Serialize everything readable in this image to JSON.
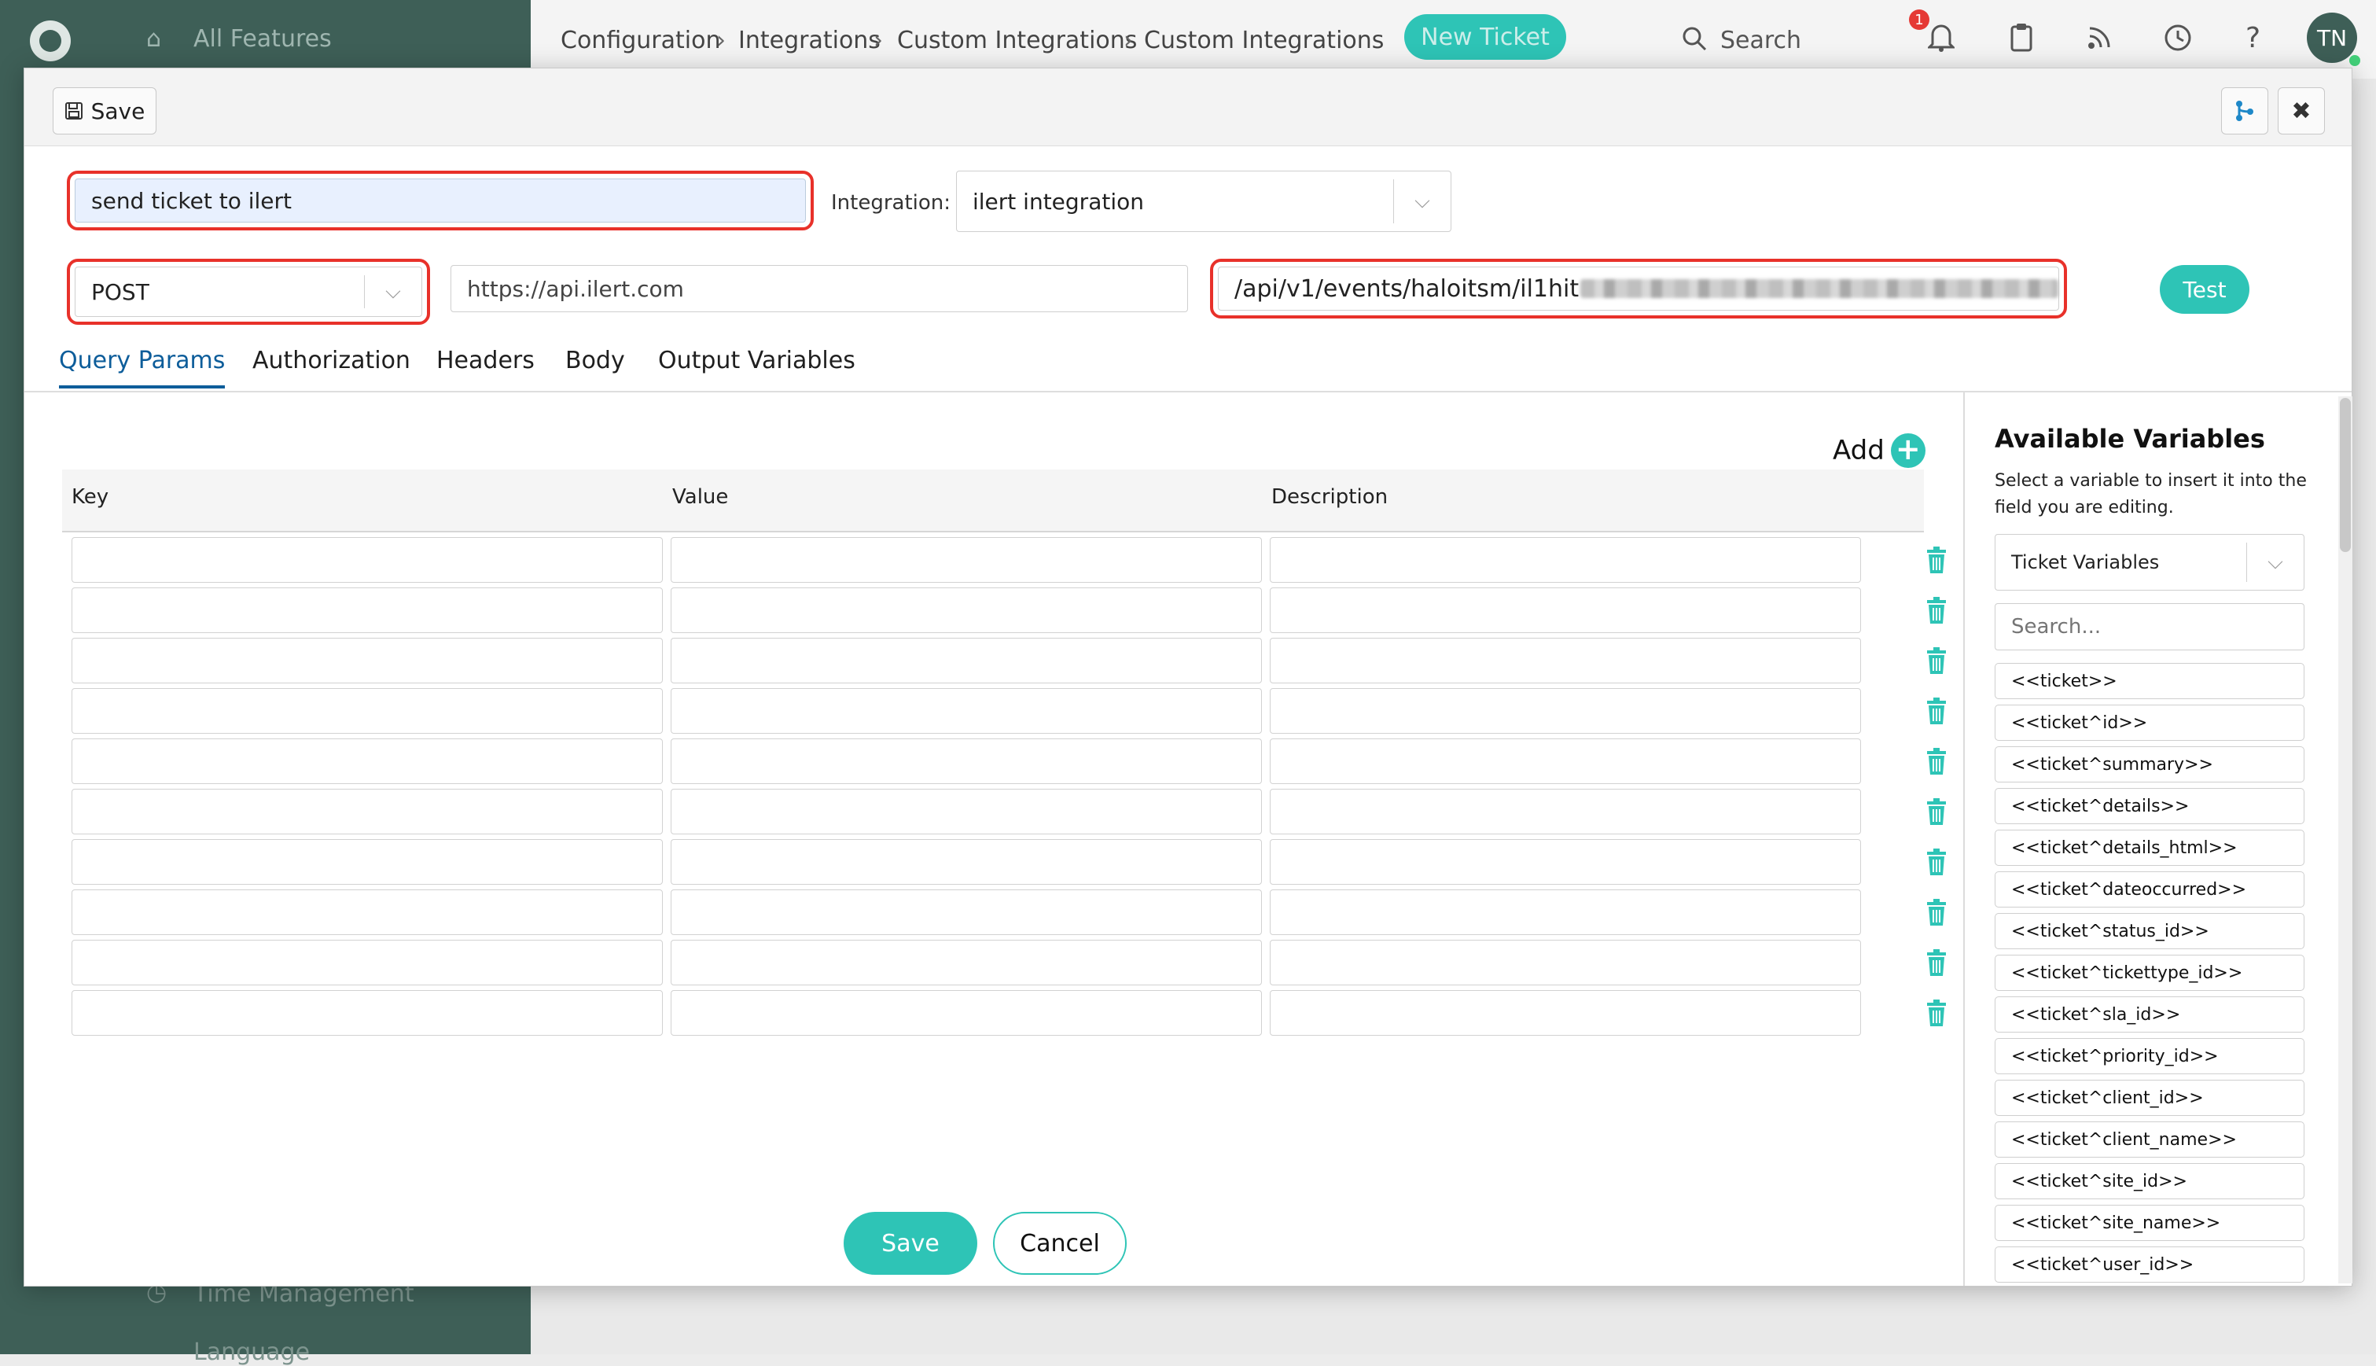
{
  "background": {
    "sidebar_top_item": "All Features",
    "sidebar_bottom_item": "Time Management",
    "sidebar_partial_item": "Language",
    "breadcrumb": [
      "Configuration",
      "Integrations",
      "Custom Integrations",
      "Custom Integrations"
    ],
    "new_ticket_label": "New Ticket",
    "search_label": "Search",
    "notification_count": "1",
    "avatar_initials": "TN"
  },
  "modal": {
    "toolbar": {
      "save_label": "Save"
    },
    "form": {
      "name_value": "send ticket to ilert",
      "integration_label": "Integration:",
      "integration_value": "ilert integration",
      "method_value": "POST",
      "base_url_value": "https://api.ilert.com",
      "path_value": "/api/v1/events/haloitsm/il1hit",
      "test_label": "Test"
    },
    "tabs": [
      {
        "label": "Query Params",
        "active": true
      },
      {
        "label": "Authorization",
        "active": false
      },
      {
        "label": "Headers",
        "active": false
      },
      {
        "label": "Body",
        "active": false
      },
      {
        "label": "Output Variables",
        "active": false
      }
    ],
    "params": {
      "add_label": "Add",
      "columns": [
        "Key",
        "Value",
        "Description"
      ],
      "row_count": 10,
      "save_label": "Save",
      "cancel_label": "Cancel"
    },
    "variables": {
      "title": "Available Variables",
      "description": "Select a variable to insert it into the field you are editing.",
      "type_value": "Ticket Variables",
      "search_placeholder": "Search...",
      "items": [
        "<<ticket>>",
        "<<ticket^id>>",
        "<<ticket^summary>>",
        "<<ticket^details>>",
        "<<ticket^details_html>>",
        "<<ticket^dateoccurred>>",
        "<<ticket^status_id>>",
        "<<ticket^tickettype_id>>",
        "<<ticket^sla_id>>",
        "<<ticket^priority_id>>",
        "<<ticket^client_id>>",
        "<<ticket^client_name>>",
        "<<ticket^site_id>>",
        "<<ticket^site_name>>",
        "<<ticket^user_id>>"
      ]
    }
  },
  "colors": {
    "accent": "#2ec4b6",
    "active_tab": "#0d5d9a",
    "highlight": "#e8312a",
    "sidebar": "#3e5f57"
  }
}
